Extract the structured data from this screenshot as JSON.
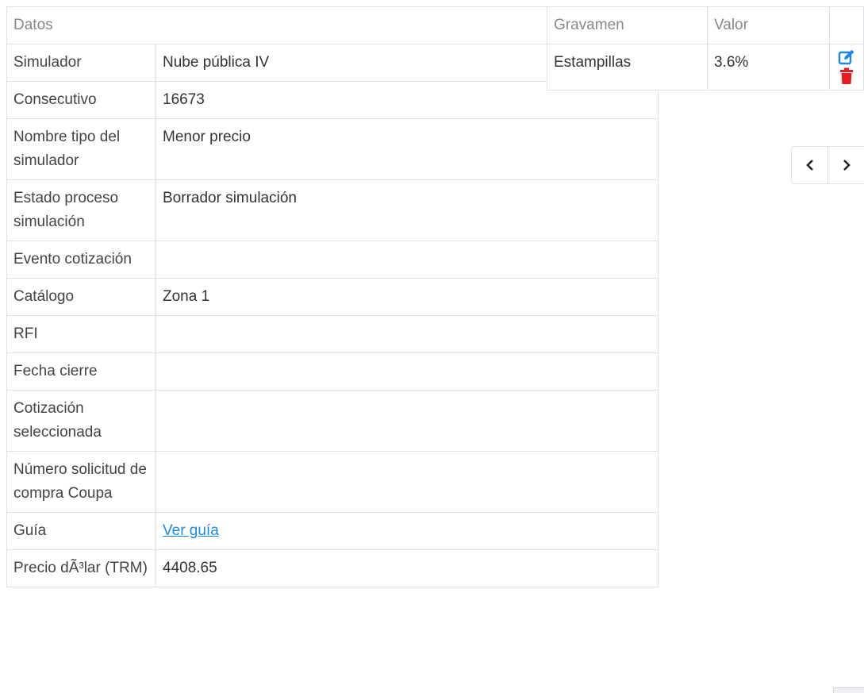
{
  "datos_table": {
    "header": "Datos",
    "rows": [
      {
        "label": "Simulador",
        "value": "Nube pública IV"
      },
      {
        "label": "Consecutivo",
        "value": "16673"
      },
      {
        "label": "Nombre tipo del simulador",
        "value": "Menor precio"
      },
      {
        "label": "Estado proceso simulación",
        "value": "Borrador simulación"
      },
      {
        "label": "Evento cotización",
        "value": ""
      },
      {
        "label": "Catálogo",
        "value": "Zona 1"
      },
      {
        "label": "RFI",
        "value": ""
      },
      {
        "label": "Fecha cierre",
        "value": ""
      },
      {
        "label": "Cotización seleccionada",
        "value": ""
      },
      {
        "label": "Número solicitud de compra Coupa",
        "value": ""
      },
      {
        "label": "Guía",
        "value": "Ver guía"
      },
      {
        "label": "Precio dÃ³lar (TRM)",
        "value": "4408.65"
      }
    ]
  },
  "gravamen_table": {
    "headers": {
      "gravamen": "Gravamen",
      "valor": "Valor"
    },
    "rows": [
      {
        "gravamen": "Estampillas",
        "valor": "3.6%"
      }
    ]
  },
  "icons": {
    "edit": "edit-icon",
    "delete": "trash-icon",
    "prev": "chevron-left-icon",
    "next": "chevron-right-icon"
  },
  "colors": {
    "edit_icon": "#1e88e5",
    "delete_icon": "#e51c23",
    "link": "#1e88e5",
    "border": "#dee2e6"
  }
}
